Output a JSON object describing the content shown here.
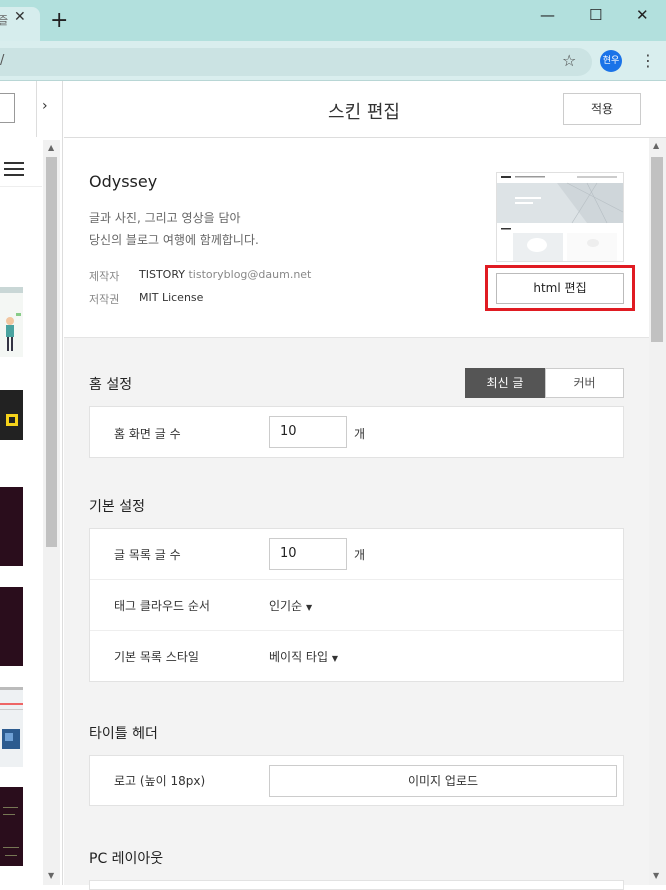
{
  "browser": {
    "tab_title": "즐",
    "tab_close": "✕",
    "new_tab": "+",
    "address": "/",
    "profile_label": "현우"
  },
  "header": {
    "title": "스킨 편집",
    "apply_label": "적용"
  },
  "skin": {
    "name": "Odyssey",
    "description_line1": "글과 사진, 그리고 영상을 담아",
    "description_line2": "당신의 블로그 여행에 함께합니다.",
    "author_label": "제작자",
    "author_name": "TISTORY",
    "author_email": "tistoryblog@daum.net",
    "license_label": "저작권",
    "license_value": "MIT License",
    "html_edit_label": "html 편집",
    "preview_heading": "Welcome to the 1st Odyssey"
  },
  "home_settings": {
    "title": "홈 설정",
    "toggle_active": "최신 글",
    "toggle_other": "커버",
    "posts_label": "홈 화면 글 수",
    "posts_value": "10",
    "unit": "개"
  },
  "basic_settings": {
    "title": "기본 설정",
    "list_count_label": "글 목록 글 수",
    "list_count_value": "10",
    "unit": "개",
    "tag_cloud_label": "태그 클라우드 순서",
    "tag_cloud_value": "인기순",
    "list_style_label": "기본 목록 스타일",
    "list_style_value": "베이직 타입"
  },
  "title_header": {
    "title": "타이틀 헤더",
    "logo_label": "로고 (높이 18px)",
    "upload_label": "이미지 업로드"
  },
  "pc_layout": {
    "title": "PC 레이아웃"
  },
  "colors": {
    "chrome_tab_bar": "#b2e0dd",
    "highlight": "#e01b22",
    "active_toggle": "#555555"
  }
}
